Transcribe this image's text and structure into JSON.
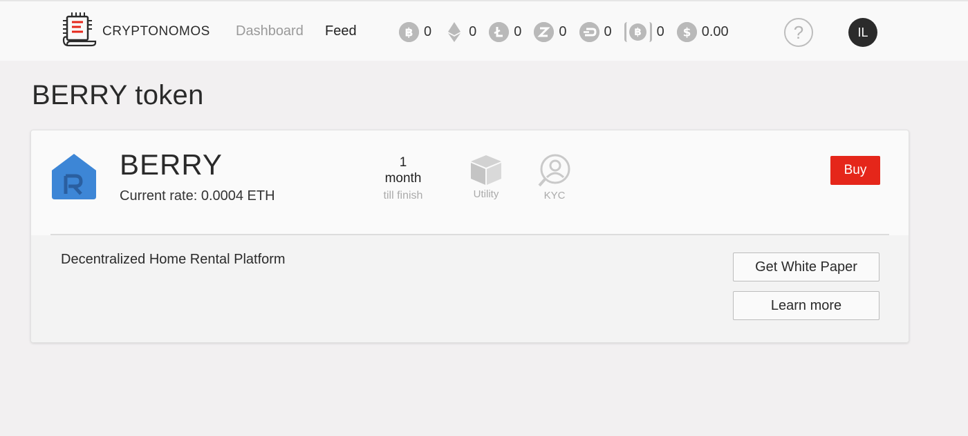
{
  "header": {
    "brand": "CRYPTONOMOS",
    "nav": {
      "dashboard": "Dashboard",
      "feed": "Feed"
    },
    "balances": [
      {
        "icon": "bitcoin-icon",
        "value": "0"
      },
      {
        "icon": "ethereum-icon",
        "value": "0"
      },
      {
        "icon": "litecoin-icon",
        "value": "0"
      },
      {
        "icon": "zcash-icon",
        "value": "0"
      },
      {
        "icon": "dash-icon",
        "value": "0"
      },
      {
        "icon": "bitcoin-cash-icon",
        "value": "0"
      },
      {
        "icon": "dollar-icon",
        "value": "0.00"
      }
    ],
    "help_icon": "?",
    "avatar_initials": "IL"
  },
  "page": {
    "title": "BERRY token"
  },
  "token": {
    "name": "BERRY",
    "rate": "Current rate: 0.0004 ETH",
    "countdown": {
      "number": "1",
      "unit": "month",
      "label": "till finish"
    },
    "features": {
      "utility": "Utility",
      "kyc": "KYC"
    },
    "buy_label": "Buy",
    "description": "Decentralized Home Rental Platform",
    "white_paper_label": "Get White Paper",
    "learn_more_label": "Learn more"
  },
  "colors": {
    "accent_red": "#e5261a",
    "token_blue": "#3d86d6",
    "muted_icon": "#b9b9b9"
  }
}
